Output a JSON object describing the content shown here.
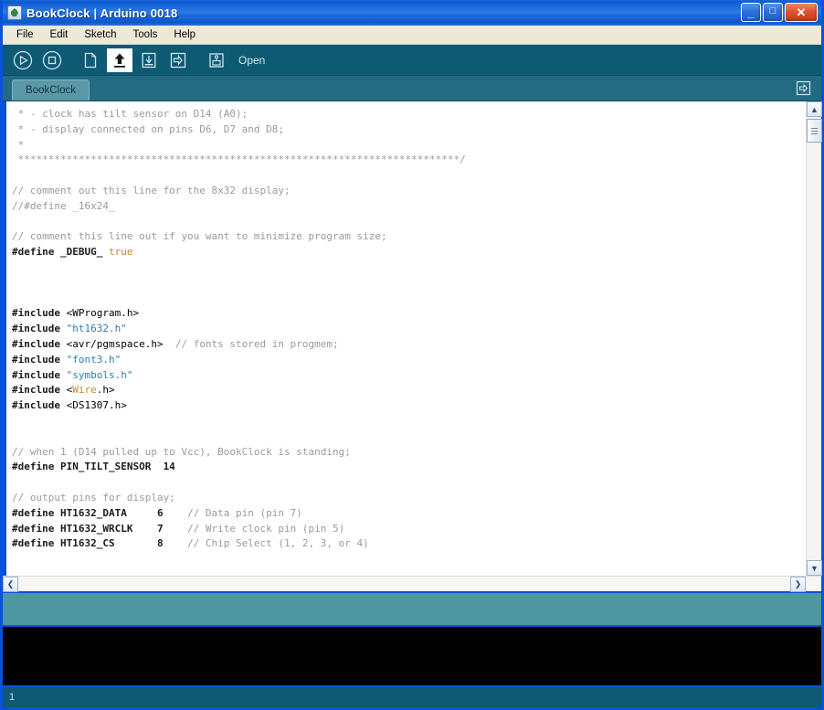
{
  "window": {
    "title": "BookClock | Arduino 0018",
    "app_icon": "arduino-icon",
    "controls": {
      "minimize": "_",
      "maximize": "□",
      "close": "✕"
    }
  },
  "menubar": {
    "items": [
      {
        "label": "File"
      },
      {
        "label": "Edit"
      },
      {
        "label": "Sketch"
      },
      {
        "label": "Tools"
      },
      {
        "label": "Help"
      }
    ]
  },
  "toolbar": {
    "buttons": [
      {
        "name": "verify-button",
        "icon": "play-circle-icon",
        "title": "Verify"
      },
      {
        "name": "stop-button",
        "icon": "stop-circle-icon",
        "title": "Stop"
      },
      {
        "name": "new-button",
        "icon": "new-file-icon",
        "title": "New"
      },
      {
        "name": "open-button",
        "icon": "open-up-arrow-icon",
        "title": "Open",
        "active": true
      },
      {
        "name": "save-button",
        "icon": "save-down-arrow-icon",
        "title": "Save"
      },
      {
        "name": "upload-button",
        "icon": "upload-right-arrow-icon",
        "title": "Upload"
      },
      {
        "name": "serial-monitor-button",
        "icon": "serial-monitor-icon",
        "title": "Serial Monitor"
      }
    ],
    "hint_label": "Open"
  },
  "tabs": {
    "items": [
      {
        "label": "BookClock",
        "active": true
      }
    ],
    "menu_icon": "tab-menu-arrow-icon"
  },
  "editor": {
    "lines": [
      [
        {
          "t": " * - clock has tilt sensor on D14 (A0);",
          "c": "cm"
        }
      ],
      [
        {
          "t": " * - display connected on pins D6, D7 and D8;",
          "c": "cm"
        }
      ],
      [
        {
          "t": " *",
          "c": "cm"
        }
      ],
      [
        {
          "t": " *************************************************************************/",
          "c": "cm"
        }
      ],
      [
        {
          "t": "",
          "c": "pl"
        }
      ],
      [
        {
          "t": "// comment out this line for the 8x32 display;",
          "c": "cm"
        }
      ],
      [
        {
          "t": "//#define _16x24_",
          "c": "cm"
        }
      ],
      [
        {
          "t": "",
          "c": "pl"
        }
      ],
      [
        {
          "t": "// comment this line out if you want to minimize program size;",
          "c": "cm"
        }
      ],
      [
        {
          "t": "#define _DEBUG_ ",
          "c": "pp"
        },
        {
          "t": "true",
          "c": "kw"
        }
      ],
      [
        {
          "t": "",
          "c": "pl"
        }
      ],
      [
        {
          "t": "",
          "c": "pl"
        }
      ],
      [
        {
          "t": "",
          "c": "pl"
        }
      ],
      [
        {
          "t": "#include ",
          "c": "pp"
        },
        {
          "t": "<WProgram.h>",
          "c": "pl"
        }
      ],
      [
        {
          "t": "#include ",
          "c": "pp"
        },
        {
          "t": "\"ht1632.h\"",
          "c": "str"
        }
      ],
      [
        {
          "t": "#include ",
          "c": "pp"
        },
        {
          "t": "<avr/pgmspace.h>",
          "c": "pl"
        },
        {
          "t": "  // fonts stored in progmem;",
          "c": "cm"
        }
      ],
      [
        {
          "t": "#include ",
          "c": "pp"
        },
        {
          "t": "\"font3.h\"",
          "c": "str"
        }
      ],
      [
        {
          "t": "#include ",
          "c": "pp"
        },
        {
          "t": "\"symbols.h\"",
          "c": "str"
        }
      ],
      [
        {
          "t": "#include ",
          "c": "pp"
        },
        {
          "t": "<",
          "c": "pl"
        },
        {
          "t": "Wire",
          "c": "kw"
        },
        {
          "t": ".h>",
          "c": "pl"
        }
      ],
      [
        {
          "t": "#include ",
          "c": "pp"
        },
        {
          "t": "<DS1307.h>",
          "c": "pl"
        }
      ],
      [
        {
          "t": "",
          "c": "pl"
        }
      ],
      [
        {
          "t": "",
          "c": "pl"
        }
      ],
      [
        {
          "t": "// when 1 (D14 pulled up to Vcc), BookClock is standing;",
          "c": "cm"
        }
      ],
      [
        {
          "t": "#define PIN_TILT_SENSOR  14",
          "c": "pp"
        }
      ],
      [
        {
          "t": "",
          "c": "pl"
        }
      ],
      [
        {
          "t": "// output pins for display;",
          "c": "cm"
        }
      ],
      [
        {
          "t": "#define HT1632_DATA     6",
          "c": "pp"
        },
        {
          "t": "    // Data pin (pin 7)",
          "c": "cm"
        }
      ],
      [
        {
          "t": "#define HT1632_WRCLK    7",
          "c": "pp"
        },
        {
          "t": "    // Write clock pin (pin 5)",
          "c": "cm"
        }
      ],
      [
        {
          "t": "#define HT1632_CS       8",
          "c": "pp"
        },
        {
          "t": "    // Chip Select (1, 2, 3, or 4)",
          "c": "cm"
        }
      ]
    ],
    "vscroll": {
      "up_arrow": "▲",
      "down_arrow": "▼"
    },
    "hscroll": {
      "left_arrow": "❮",
      "right_arrow": "❯"
    }
  },
  "console": {
    "text": ""
  },
  "statusbar": {
    "line_number": "1"
  },
  "colors": {
    "title_blue": "#1464d6",
    "toolbar_teal": "#0f5a73",
    "tabbar_teal": "#226b82",
    "tab_active": "#5a98a8",
    "status_strip": "#4f96a3",
    "console_bg": "#000000",
    "comment": "#9a9a9a",
    "string": "#2e7fa8",
    "keyword": "#c08a2e",
    "menubar_bg": "#ece9d8"
  }
}
